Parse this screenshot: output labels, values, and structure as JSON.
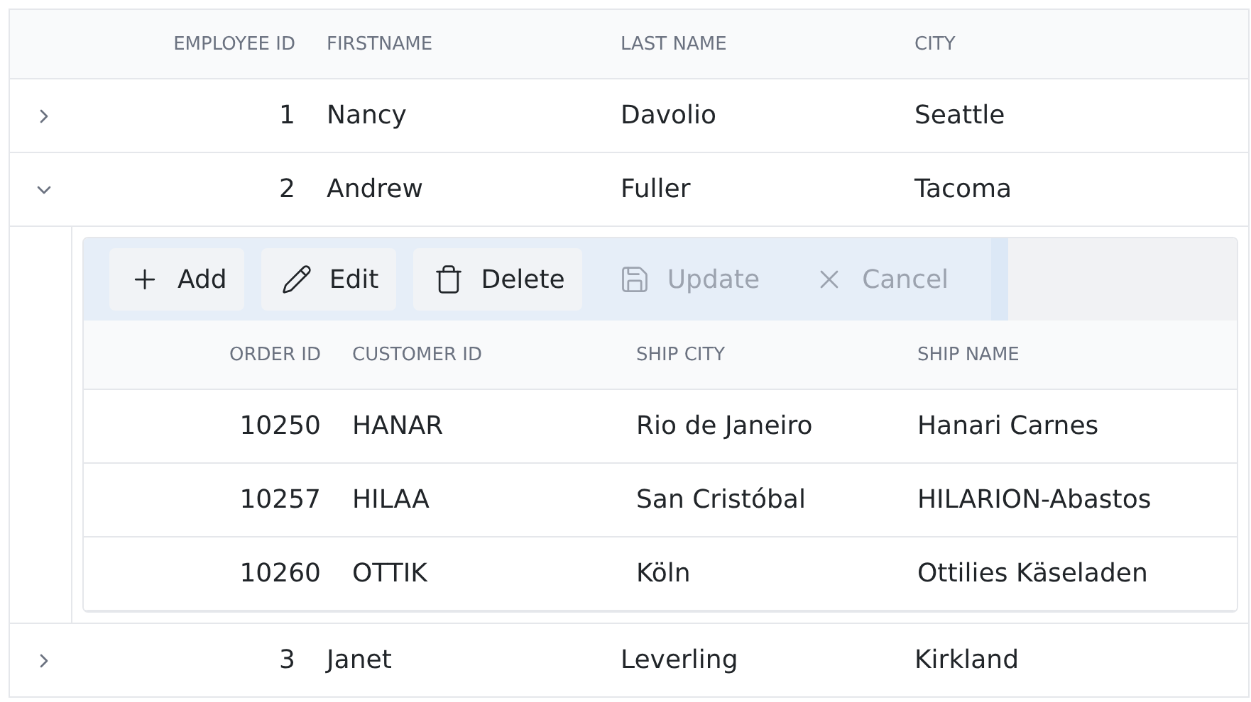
{
  "grid": {
    "columns": [
      "EMPLOYEE ID",
      "FIRSTNAME",
      "LAST NAME",
      "CITY"
    ],
    "rows": [
      {
        "cells": [
          "1",
          "Nancy",
          "Davolio",
          "Seattle"
        ],
        "expanded": false
      },
      {
        "cells": [
          "2",
          "Andrew",
          "Fuller",
          "Tacoma"
        ],
        "expanded": true,
        "detail": {
          "toolbar": [
            {
              "kind": "add",
              "label": "Add",
              "disabled": false
            },
            {
              "kind": "edit",
              "label": "Edit",
              "disabled": false
            },
            {
              "kind": "delete",
              "label": "Delete",
              "disabled": false
            },
            {
              "kind": "update",
              "label": "Update",
              "disabled": true
            },
            {
              "kind": "cancel",
              "label": "Cancel",
              "disabled": true
            }
          ],
          "columns": [
            "ORDER ID",
            "CUSTOMER ID",
            "SHIP CITY",
            "SHIP NAME"
          ],
          "rows": [
            [
              "10250",
              "HANAR",
              "Rio de Janeiro",
              "Hanari Carnes"
            ],
            [
              "10257",
              "HILAA",
              "San Cristóbal",
              "HILARION-Abastos"
            ],
            [
              "10260",
              "OTTIK",
              "Köln",
              "Ottilies Käseladen"
            ]
          ]
        }
      },
      {
        "cells": [
          "3",
          "Janet",
          "Leverling",
          "Kirkland"
        ],
        "expanded": false
      }
    ]
  }
}
